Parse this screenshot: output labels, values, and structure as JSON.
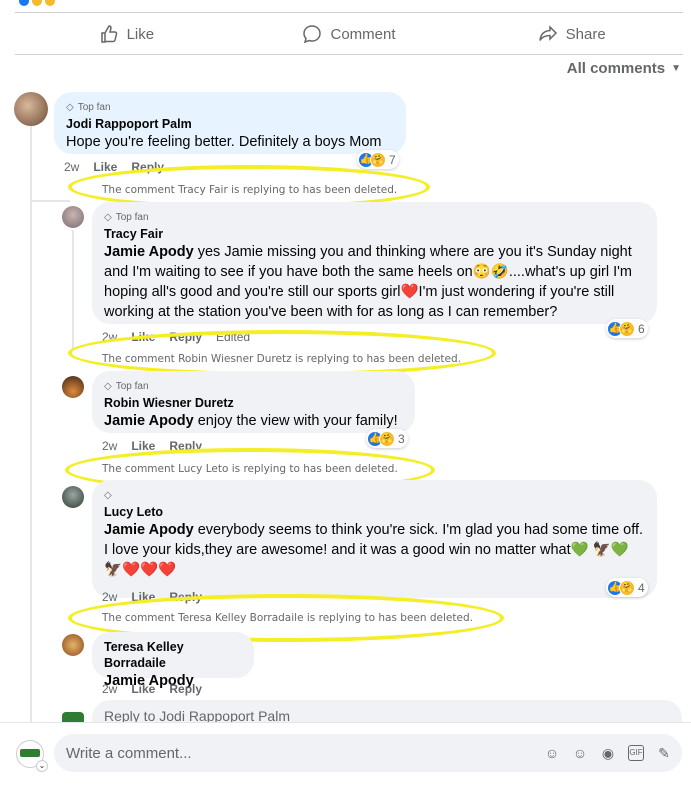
{
  "actions": {
    "like": "Like",
    "comment": "Comment",
    "share": "Share"
  },
  "sort": {
    "label": "All comments"
  },
  "top_fan_label": "Top fan",
  "comments": [
    {
      "author": "Jodi Rappoport Palm",
      "text": "Hope you're feeling better. Definitely a boys Mom",
      "time": "2w",
      "like": "Like",
      "reply": "Reply",
      "reactions": "7"
    },
    {
      "deleted_notice": "The comment Tracy Fair is replying to has been deleted.",
      "author": "Tracy Fair",
      "mention": "Jamie Apody",
      "text": " yes Jamie missing you and thinking where are you it's Sunday night and I'm waiting to see if you have both the same heels on😳🤣....what's up girl I'm hoping all's good and you're still our sports girl❤️I'm just wondering if you're still working at the station you've been with for as long as I can remember?",
      "time": "2w",
      "like": "Like",
      "reply": "Reply",
      "edited": "Edited",
      "reactions": "6"
    },
    {
      "deleted_notice": "The comment Robin Wiesner Duretz is replying to has been deleted.",
      "author": "Robin Wiesner Duretz",
      "mention": "Jamie Apody",
      "text": " enjoy the view with your family!",
      "time": "2w",
      "like": "Like",
      "reply": "Reply",
      "reactions": "3"
    },
    {
      "deleted_notice": "The comment Lucy Leto is replying to has been deleted.",
      "author": "Lucy Leto",
      "mention": "Jamie Apody",
      "text": " everybody seems to think you're sick. I'm glad you had some time off. I love your kids,they are awesome! and it was a good win no matter what💚 🦅💚🦅❤️❤️❤️",
      "time": "2w",
      "like": "Like",
      "reply": "Reply",
      "reactions": "4"
    },
    {
      "deleted_notice": "The comment Teresa Kelley Borradaile is replying to has been deleted.",
      "author": "Teresa Kelley Borradaile",
      "mention": "Jamie Apody",
      "time": "2w",
      "like": "Like",
      "reply": "Reply"
    }
  ],
  "reply_placeholder": "Reply to Jodi Rappoport Palm",
  "composer": {
    "placeholder": "Write a comment..."
  },
  "colors": {
    "highlight_oval": "#f3ee26",
    "like_blue": "#1877f2"
  }
}
